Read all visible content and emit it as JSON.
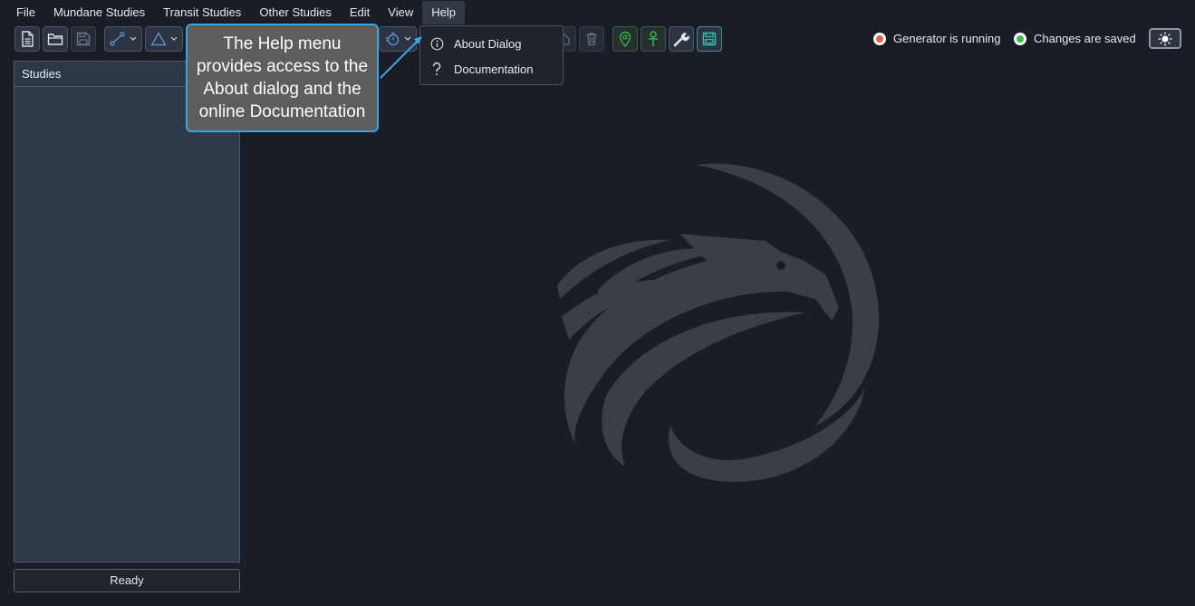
{
  "menubar": {
    "items": [
      "File",
      "Mundane Studies",
      "Transit Studies",
      "Other Studies",
      "Edit",
      "View",
      "Help"
    ]
  },
  "toolbar": {
    "icons": [
      "new-file-icon",
      "open-folder-icon",
      "save-icon",
      "link-dropdown-icon",
      "triangle-dropdown-icon",
      "timer-dropdown-icon",
      "home-icon",
      "trash-icon",
      "location-pin-icon",
      "ankh-icon",
      "wrench-icon",
      "save-changes-icon"
    ]
  },
  "status": {
    "generator": "Generator is running",
    "saved": "Changes are saved",
    "generator_color": "#e8643a",
    "saved_color": "#3fbf4a"
  },
  "studies_panel": {
    "title": "Studies"
  },
  "status_bar": {
    "text": "Ready"
  },
  "help_menu": {
    "items": [
      {
        "label": "About Dialog",
        "icon": "info-icon"
      },
      {
        "label": "Documentation",
        "icon": "question-icon"
      }
    ]
  },
  "callout": {
    "text": "The Help menu provides access to the About dialog and the online Documentation"
  },
  "colors": {
    "accent": "#3ba3e0",
    "background": "#1a1d25",
    "panel": "#2e3a4a"
  }
}
